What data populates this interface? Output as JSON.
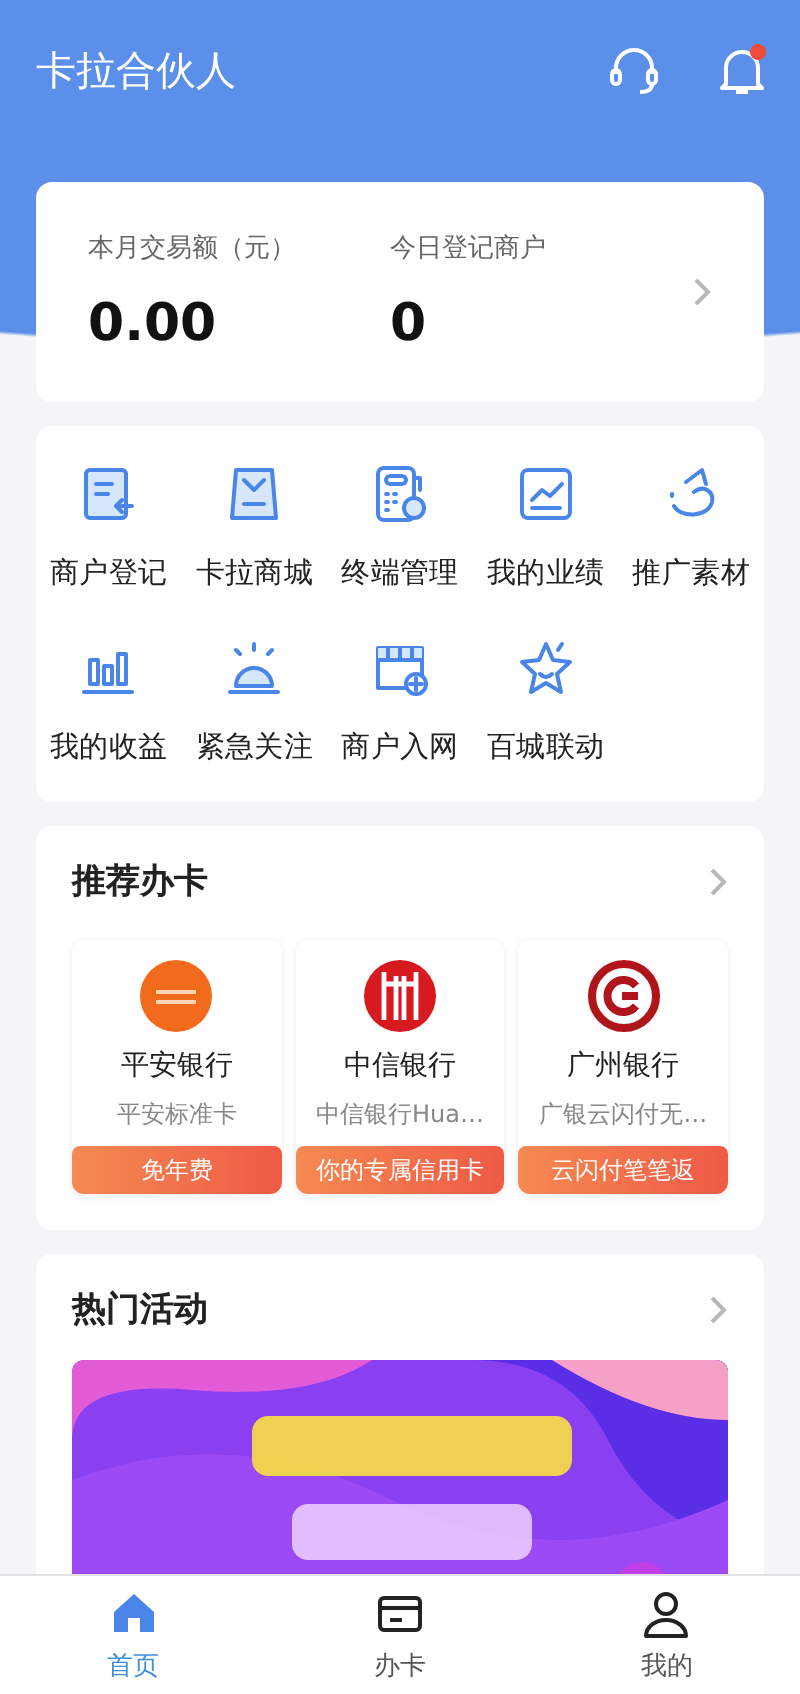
{
  "header": {
    "title": "卡拉合伙人",
    "has_notification": true
  },
  "stats": [
    {
      "label": "本月交易额（元）",
      "value": "0.00"
    },
    {
      "label": "今日登记商户",
      "value": "0"
    }
  ],
  "menu": [
    {
      "label": "商户登记",
      "kind": "register"
    },
    {
      "label": "卡拉商城",
      "kind": "shop"
    },
    {
      "label": "终端管理",
      "kind": "terminal"
    },
    {
      "label": "我的业绩",
      "kind": "chart"
    },
    {
      "label": "推广素材",
      "kind": "share"
    },
    {
      "label": "我的收益",
      "kind": "bars"
    },
    {
      "label": "紧急关注",
      "kind": "alarm"
    },
    {
      "label": "商户入网",
      "kind": "store"
    },
    {
      "label": "百城联动",
      "kind": "star"
    }
  ],
  "recommend": {
    "title": "推荐办卡",
    "cards": [
      {
        "bank": "平安银行",
        "product": "平安标准卡",
        "tag": "免年费",
        "kind": "orange"
      },
      {
        "bank": "中信银行",
        "product": "中信银行Hua…",
        "tag": "你的专属信用卡",
        "kind": "redlines"
      },
      {
        "bank": "广州银行",
        "product": "广银云闪付无…",
        "tag": "云闪付笔笔返",
        "kind": "redring"
      }
    ]
  },
  "activities": {
    "title": "热门活动"
  },
  "tabs": [
    {
      "label": "首页",
      "selected": true,
      "kind": "home"
    },
    {
      "label": "办卡",
      "selected": false,
      "kind": "card"
    },
    {
      "label": "我的",
      "selected": false,
      "kind": "person"
    }
  ]
}
